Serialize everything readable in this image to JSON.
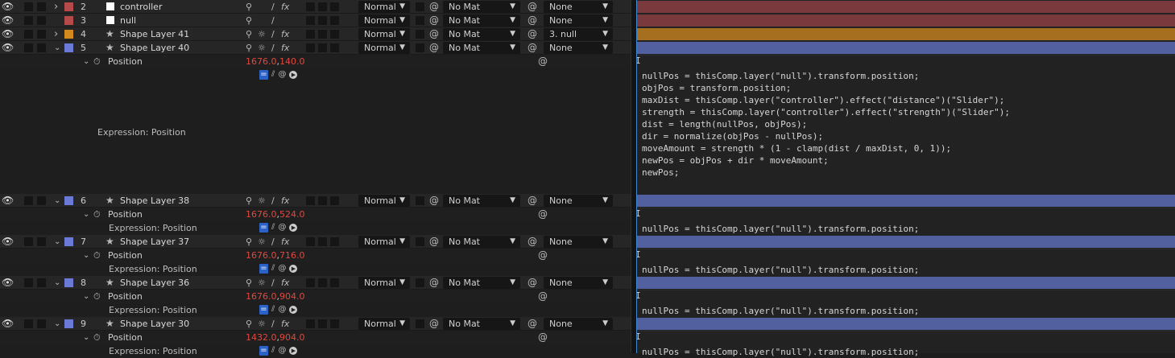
{
  "layers": [
    {
      "num": "2",
      "name": "controller",
      "color": "#b44a4a",
      "icon": "solid",
      "mode": "Normal",
      "matte": "No Mat",
      "parent": "None",
      "barColor": "#7a3a3d",
      "expandable": true,
      "expanded": false
    },
    {
      "num": "3",
      "name": "null",
      "color": "#b44a4a",
      "icon": "solid",
      "mode": "Normal",
      "matte": "No Mat",
      "parent": "None",
      "barColor": "#7a3a3d",
      "expandable": false,
      "expanded": false
    },
    {
      "num": "4",
      "name": "Shape Layer 41",
      "color": "#d38a1c",
      "icon": "star",
      "mode": "Normal",
      "matte": "No Mat",
      "parent": "3. null",
      "barColor": "#a66e1f",
      "expandable": true,
      "expanded": false
    },
    {
      "num": "5",
      "name": "Shape Layer 40",
      "color": "#6b7ad6",
      "icon": "star",
      "mode": "Normal",
      "matte": "No Mat",
      "parent": "None",
      "barColor": "#5360a0",
      "expandable": true,
      "expanded": true
    },
    {
      "num": "6",
      "name": "Shape Layer 38",
      "color": "#6b7ad6",
      "icon": "star",
      "mode": "Normal",
      "matte": "No Mat",
      "parent": "None",
      "barColor": "#5360a0",
      "expandable": true,
      "expanded": true
    },
    {
      "num": "7",
      "name": "Shape Layer 37",
      "color": "#6b7ad6",
      "icon": "star",
      "mode": "Normal",
      "matte": "No Mat",
      "parent": "None",
      "barColor": "#5360a0",
      "expandable": true,
      "expanded": true
    },
    {
      "num": "8",
      "name": "Shape Layer 36",
      "color": "#6b7ad6",
      "icon": "star",
      "mode": "Normal",
      "matte": "No Mat",
      "parent": "None",
      "barColor": "#5360a0",
      "expandable": true,
      "expanded": true
    },
    {
      "num": "9",
      "name": "Shape Layer 30",
      "color": "#6b7ad6",
      "icon": "star",
      "mode": "Normal",
      "matte": "No Mat",
      "parent": "None",
      "barColor": "#5360a0",
      "expandable": true,
      "expanded": true
    }
  ],
  "properties": [
    {
      "layer": "5",
      "name": "Position",
      "x": "1676.0",
      "y": "140.0",
      "exprLabel": "Expression: Position",
      "code": [
        "nullPos = thisComp.layer(\"null\").transform.position;",
        "objPos = transform.position;",
        "maxDist = thisComp.layer(\"controller\").effect(\"distance\")(\"Slider\");",
        "strength = thisComp.layer(\"controller\").effect(\"strength\")(\"Slider\");",
        "dist = length(nullPos, objPos);",
        "dir = normalize(objPos - nullPos);",
        "moveAmount = strength * (1 - clamp(dist / maxDist, 0, 1));",
        "newPos = objPos + dir * moveAmount;",
        "newPos;"
      ]
    },
    {
      "layer": "6",
      "name": "Position",
      "x": "1676.0",
      "y": "524.0",
      "exprLabel": "Expression: Position",
      "code": [
        "nullPos = thisComp.layer(\"null\").transform.position;"
      ]
    },
    {
      "layer": "7",
      "name": "Position",
      "x": "1676.0",
      "y": "716.0",
      "exprLabel": "Expression: Position",
      "code": [
        "nullPos = thisComp.layer(\"null\").transform.position;"
      ]
    },
    {
      "layer": "8",
      "name": "Position",
      "x": "1676.0",
      "y": "904.0",
      "exprLabel": "Expression: Position",
      "code": [
        "nullPos = thisComp.layer(\"null\").transform.position;"
      ]
    },
    {
      "layer": "9",
      "name": "Position",
      "x": "1432.0",
      "y": "904.0",
      "exprLabel": "Expression: Position",
      "code": [
        "nullPos = thisComp.layer(\"null\").transform.position;"
      ]
    }
  ],
  "glyphs": {
    "eye": "👁",
    "chevronRight": "›",
    "chevronDown": "⌄",
    "star": "★",
    "stopwatch": "⏱",
    "spiral": "@",
    "fx": "fx",
    "shy": "⚲",
    "collapse": "☼",
    "slash": "/",
    "ddArrow": "▼",
    "ibeam": "I",
    "eq": "=",
    "graph": "⫽",
    "play": "▶",
    "comma": ","
  }
}
